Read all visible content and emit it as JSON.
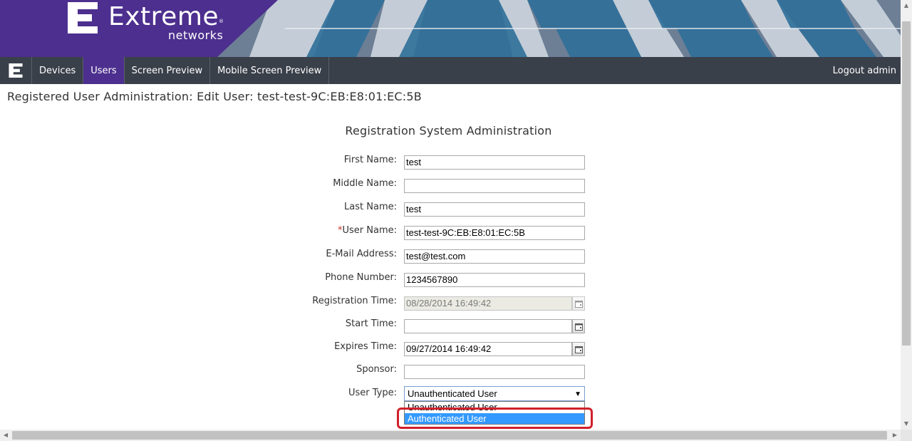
{
  "brand": {
    "name": "Extreme",
    "trademark": "®",
    "sub": "networks",
    "colors": {
      "purple": "#4c2f8e",
      "nav": "#3a404a"
    }
  },
  "nav": {
    "items": [
      {
        "label": "Devices",
        "active": false
      },
      {
        "label": "Users",
        "active": true
      },
      {
        "label": "Screen Preview",
        "active": false
      },
      {
        "label": "Mobile Screen Preview",
        "active": false
      }
    ],
    "logout": "Logout admin"
  },
  "page_title": "Registered User Administration: Edit User: test-test-9C:EB:E8:01:EC:5B",
  "form": {
    "title": "Registration System Administration",
    "first_name": {
      "label": "First Name:",
      "value": "test"
    },
    "middle_name": {
      "label": "Middle Name:",
      "value": ""
    },
    "last_name": {
      "label": "Last Name:",
      "value": "test"
    },
    "user_name": {
      "required_mark": "*",
      "label": "User Name:",
      "value": "test-test-9C:EB:E8:01:EC:5B"
    },
    "email": {
      "label": "E-Mail Address:",
      "value": "test@test.com"
    },
    "phone": {
      "label": "Phone Number:",
      "value": "1234567890"
    },
    "registration_time": {
      "label": "Registration Time:",
      "value": "08/28/2014 16:49:42",
      "disabled": true
    },
    "start_time": {
      "label": "Start Time:",
      "value": ""
    },
    "expires_time": {
      "label": "Expires Time:",
      "value": "09/27/2014 16:49:42"
    },
    "sponsor": {
      "label": "Sponsor:",
      "value": ""
    },
    "user_type": {
      "label": "User Type:",
      "selected": "Unauthenticated User",
      "options": [
        "Unauthenticated User",
        "Authenticated User"
      ],
      "highlighted": "Authenticated User"
    }
  },
  "icons": {
    "calendar": "calendar-icon",
    "dropdown_arrow": "▼",
    "scroll_up": "▲",
    "scroll_down": "▼",
    "scroll_left": "◀",
    "scroll_right": "▶"
  },
  "annotation_color": "#d0202a"
}
